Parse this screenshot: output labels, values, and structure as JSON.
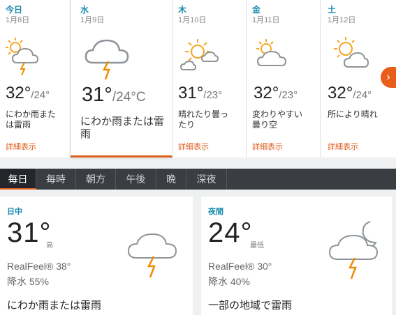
{
  "days": [
    {
      "dow": "今日",
      "date": "1月8日",
      "high": "32°",
      "low": "/24°",
      "desc": "にわか雨または雷雨",
      "more": "詳細表示",
      "icon": "sun-cloud-thunder-icon"
    },
    {
      "dow": "水",
      "date": "1月9日",
      "high": "31°",
      "low": "/24°C",
      "desc": "にわか雨または雷雨",
      "icon": "cloud-thunder-icon"
    },
    {
      "dow": "木",
      "date": "1月10日",
      "high": "31°",
      "low": "/23°",
      "desc": "晴れたり曇ったり",
      "more": "詳細表示",
      "icon": "sun-cloud-icon"
    },
    {
      "dow": "金",
      "date": "1月11日",
      "high": "32°",
      "low": "/23°",
      "desc": "変わりやすい曇り空",
      "more": "詳細表示",
      "icon": "sun-cloud-icon"
    },
    {
      "dow": "土",
      "date": "1月12日",
      "high": "32°",
      "low": "/24°",
      "desc": "所により晴れ",
      "more": "詳細表示",
      "icon": "sun-cloud-icon"
    }
  ],
  "next_icon": "chevron-right-icon",
  "next_glyph": "›",
  "tabs": [
    "毎日",
    "毎時",
    "朝方",
    "午後",
    "晩",
    "深夜"
  ],
  "day_panel": {
    "label": "日中",
    "temp": "31°",
    "sub": "高",
    "realfeel": "RealFeel® 38°",
    "precip": "降水 55%",
    "desc": "にわか雨または雷雨",
    "icon": "cloud-thunder-icon"
  },
  "night_panel": {
    "label": "夜間",
    "temp": "24°",
    "sub": "最低",
    "realfeel": "RealFeel® 30°",
    "precip": "降水 40%",
    "desc": "一部の地域で雷雨",
    "icon": "moon-cloud-thunder-icon"
  },
  "colors": {
    "accent": "#e0601e",
    "link": "#1a8ab0",
    "sun": "#f5a623",
    "bolt": "#f08a00",
    "cloud": "#8e9499"
  }
}
